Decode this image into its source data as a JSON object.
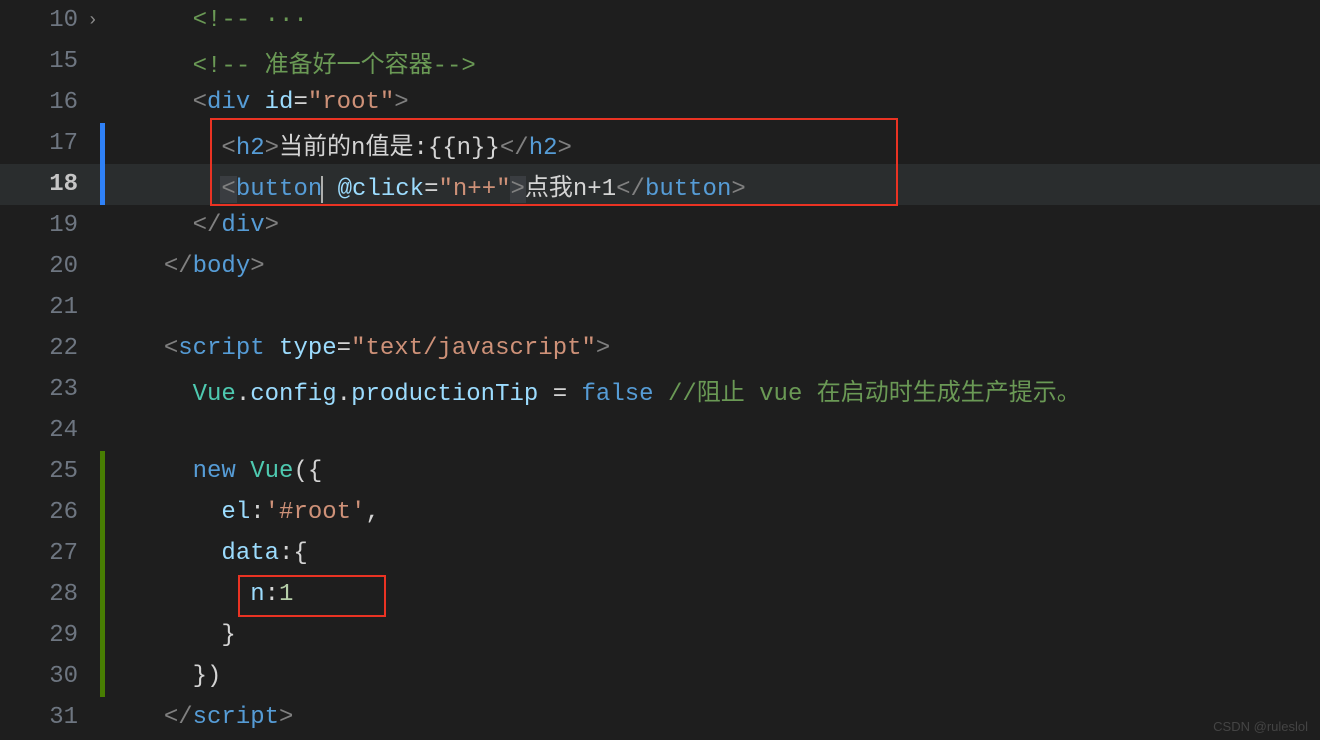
{
  "watermark": "CSDN @ruleslol",
  "lines": [
    {
      "num": "10",
      "indent": 2,
      "marker": "",
      "fold": true,
      "tokens": [
        {
          "t": "<!-- ",
          "c": "c-comment"
        },
        {
          "t": "···",
          "c": "c-comment"
        }
      ]
    },
    {
      "num": "15",
      "indent": 2,
      "marker": "",
      "tokens": [
        {
          "t": "<!-- ",
          "c": "c-comment"
        },
        {
          "t": "准备好一个容器",
          "c": "c-comment"
        },
        {
          "t": "-->",
          "c": "c-comment"
        }
      ]
    },
    {
      "num": "16",
      "indent": 2,
      "marker": "",
      "tokens": [
        {
          "t": "<",
          "c": "c-bracket"
        },
        {
          "t": "div",
          "c": "c-tag"
        },
        {
          "t": " ",
          "c": "c-text"
        },
        {
          "t": "id",
          "c": "c-attr"
        },
        {
          "t": "=",
          "c": "c-text"
        },
        {
          "t": "\"root\"",
          "c": "c-string"
        },
        {
          "t": ">",
          "c": "c-bracket"
        }
      ]
    },
    {
      "num": "17",
      "indent": 3,
      "marker": "blue",
      "tokens": [
        {
          "t": "<",
          "c": "c-bracket"
        },
        {
          "t": "h2",
          "c": "c-tag"
        },
        {
          "t": ">",
          "c": "c-bracket"
        },
        {
          "t": "当前的n值是:{{n}}",
          "c": "c-text"
        },
        {
          "t": "</",
          "c": "c-bracket"
        },
        {
          "t": "h2",
          "c": "c-tag"
        },
        {
          "t": ">",
          "c": "c-bracket"
        }
      ]
    },
    {
      "num": "18",
      "indent": 3,
      "marker": "blue",
      "current": true,
      "tokens": [
        {
          "t": "<",
          "c": "c-bracket hl-br"
        },
        {
          "t": "button",
          "c": "c-tag"
        },
        {
          "t": "",
          "c": "cur"
        },
        {
          "t": " ",
          "c": "c-text"
        },
        {
          "t": "@click",
          "c": "c-attr"
        },
        {
          "t": "=",
          "c": "c-text"
        },
        {
          "t": "\"n++\"",
          "c": "c-string"
        },
        {
          "t": ">",
          "c": "c-bracket hl-br"
        },
        {
          "t": "点我n+1",
          "c": "c-text"
        },
        {
          "t": "</",
          "c": "c-bracket"
        },
        {
          "t": "button",
          "c": "c-tag"
        },
        {
          "t": ">",
          "c": "c-bracket"
        }
      ]
    },
    {
      "num": "19",
      "indent": 2,
      "marker": "",
      "tokens": [
        {
          "t": "</",
          "c": "c-bracket"
        },
        {
          "t": "div",
          "c": "c-tag"
        },
        {
          "t": ">",
          "c": "c-bracket"
        }
      ]
    },
    {
      "num": "20",
      "indent": 1,
      "marker": "",
      "tokens": [
        {
          "t": "</",
          "c": "c-bracket"
        },
        {
          "t": "body",
          "c": "c-tag"
        },
        {
          "t": ">",
          "c": "c-bracket"
        }
      ]
    },
    {
      "num": "21",
      "indent": 0,
      "marker": "",
      "tokens": []
    },
    {
      "num": "22",
      "indent": 1,
      "marker": "",
      "tokens": [
        {
          "t": "<",
          "c": "c-bracket"
        },
        {
          "t": "script",
          "c": "c-tag"
        },
        {
          "t": " ",
          "c": "c-text"
        },
        {
          "t": "type",
          "c": "c-attr"
        },
        {
          "t": "=",
          "c": "c-text"
        },
        {
          "t": "\"text/javascript\"",
          "c": "c-string"
        },
        {
          "t": ">",
          "c": "c-bracket"
        }
      ]
    },
    {
      "num": "23",
      "indent": 2,
      "marker": "",
      "tokens": [
        {
          "t": "Vue",
          "c": "c-class"
        },
        {
          "t": ".",
          "c": "c-punc"
        },
        {
          "t": "config",
          "c": "c-prop"
        },
        {
          "t": ".",
          "c": "c-punc"
        },
        {
          "t": "productionTip",
          "c": "c-prop"
        },
        {
          "t": " = ",
          "c": "c-punc"
        },
        {
          "t": "false",
          "c": "c-bool"
        },
        {
          "t": " ",
          "c": "c-text"
        },
        {
          "t": "//阻止 vue 在启动时生成生产提示。",
          "c": "c-comment"
        }
      ]
    },
    {
      "num": "24",
      "indent": 0,
      "marker": "",
      "tokens": []
    },
    {
      "num": "25",
      "indent": 2,
      "marker": "green",
      "tokens": [
        {
          "t": "new",
          "c": "c-kw"
        },
        {
          "t": " ",
          "c": "c-text"
        },
        {
          "t": "Vue",
          "c": "c-class"
        },
        {
          "t": "({",
          "c": "c-punc"
        }
      ]
    },
    {
      "num": "26",
      "indent": 3,
      "marker": "green",
      "tokens": [
        {
          "t": "el",
          "c": "c-prop"
        },
        {
          "t": ":",
          "c": "c-punc"
        },
        {
          "t": "'#root'",
          "c": "c-string"
        },
        {
          "t": ",",
          "c": "c-punc"
        }
      ]
    },
    {
      "num": "27",
      "indent": 3,
      "marker": "green",
      "tokens": [
        {
          "t": "data",
          "c": "c-prop"
        },
        {
          "t": ":{",
          "c": "c-punc"
        }
      ]
    },
    {
      "num": "28",
      "indent": 4,
      "marker": "green",
      "tokens": [
        {
          "t": "n",
          "c": "c-prop"
        },
        {
          "t": ":",
          "c": "c-punc"
        },
        {
          "t": "1",
          "c": "c-num"
        }
      ]
    },
    {
      "num": "29",
      "indent": 3,
      "marker": "green",
      "tokens": [
        {
          "t": "}",
          "c": "c-punc"
        }
      ]
    },
    {
      "num": "30",
      "indent": 2,
      "marker": "green",
      "tokens": [
        {
          "t": "})",
          "c": "c-punc"
        }
      ]
    },
    {
      "num": "31",
      "indent": 1,
      "marker": "",
      "tokens": [
        {
          "t": "</",
          "c": "c-bracket"
        },
        {
          "t": "script",
          "c": "c-tag"
        },
        {
          "t": ">",
          "c": "c-bracket"
        }
      ]
    }
  ]
}
